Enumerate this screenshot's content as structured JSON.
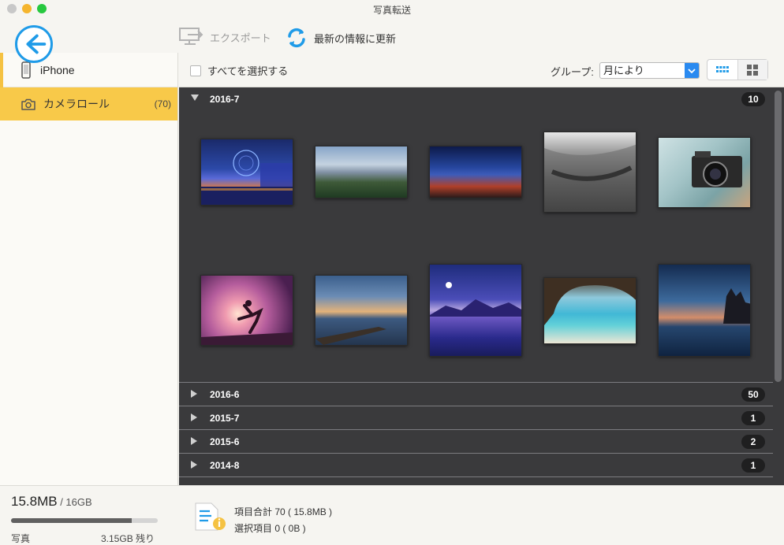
{
  "window": {
    "title": "写真転送"
  },
  "toolbar": {
    "export_label": "エクスポート",
    "refresh_label": "最新の情報に更新"
  },
  "sidebar": {
    "device": "iPhone",
    "items": [
      {
        "label": "カメラロール",
        "count": "(70)"
      }
    ]
  },
  "filter": {
    "select_all_label": "すべてを選択する",
    "group_label": "グループ:",
    "group_value": "月により"
  },
  "groups": [
    {
      "name": "2016-7",
      "count": "10",
      "expanded": true
    },
    {
      "name": "2016-6",
      "count": "50",
      "expanded": false
    },
    {
      "name": "2015-7",
      "count": "1",
      "expanded": false
    },
    {
      "name": "2015-6",
      "count": "2",
      "expanded": false
    },
    {
      "name": "2014-8",
      "count": "1",
      "expanded": false
    }
  ],
  "photos": [
    {
      "name": "London Eye at night"
    },
    {
      "name": "Mountain valley panorama"
    },
    {
      "name": "Milky way night sky"
    },
    {
      "name": "Curved street black and white"
    },
    {
      "name": "Vintage Zenit camera"
    },
    {
      "name": "Silhouette jumper at sunset"
    },
    {
      "name": "Lake with driftwood at dusk"
    },
    {
      "name": "Moonlit mountains reflection"
    },
    {
      "name": "Sea cave beach"
    },
    {
      "name": "Castle by the lake at dusk"
    }
  ],
  "footer": {
    "used": "15.8MB",
    "total": " / 16GB",
    "type": "写真",
    "free": "3.15GB 残り",
    "usage_fraction": 0.82,
    "summary_total": "項目合計 70 ( 15.8MB )",
    "summary_selected": "選択項目 0 ( 0B )"
  },
  "colors": {
    "accent_blue": "#1f9be8",
    "selection_yellow": "#f8c949",
    "content_bg": "#3a3a3c"
  }
}
